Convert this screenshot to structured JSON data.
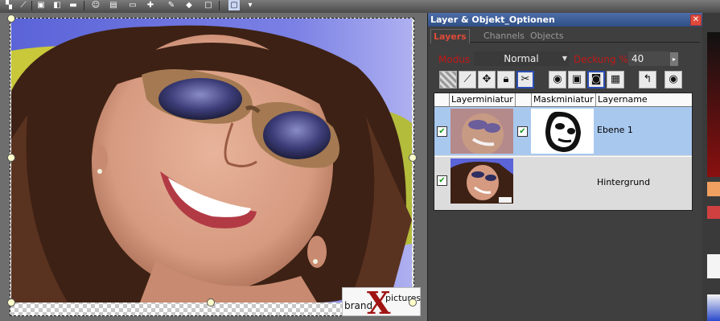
{
  "toolbar": {
    "icons": [
      "selection-tool-icon",
      "crop-tool-icon",
      "image-icon",
      "color-icon",
      "face-icon",
      "film-icon",
      "document-icon",
      "plugin-icon",
      "paint-icon",
      "blank-page-icon",
      "monitor-icon",
      "more-icon"
    ]
  },
  "canvas": {
    "logo_brand": "brand",
    "logo_letter": "X",
    "logo_pictures": "pictures"
  },
  "panel": {
    "title": "Layer & Objekt_Optionen",
    "close_glyph": "✕",
    "tabs": [
      {
        "label": "Layers",
        "active": true
      },
      {
        "label": "Channels",
        "active": false
      },
      {
        "label": "Objects",
        "active": false
      }
    ],
    "mode_label": "Modus",
    "mode_value": "Normal",
    "opacity_label": "Deckung %",
    "opacity_value": "40",
    "tools": [
      "checker-icon",
      "brush-icon",
      "move-icon",
      "lock-icon",
      "scissors-icon",
      "eye-icon",
      "mask-icon",
      "mask-active-icon",
      "layer-copy-icon",
      "undo-icon",
      "visibility-icon"
    ],
    "columns": {
      "thumb": "Layerminiatur",
      "mask": "Maskminiatur",
      "name": "Layername"
    },
    "layers": [
      {
        "name": "Ebene 1",
        "visible": true,
        "mask_linked": true,
        "selected": true
      },
      {
        "name": "Hintergrund",
        "visible": true,
        "mask_linked": false,
        "selected": false
      }
    ]
  },
  "colors": {
    "title_bar": "#3b5c98",
    "active_tab": "#e04a3a",
    "label_red": "#c41818",
    "selected_row": "#a8c8ee"
  }
}
